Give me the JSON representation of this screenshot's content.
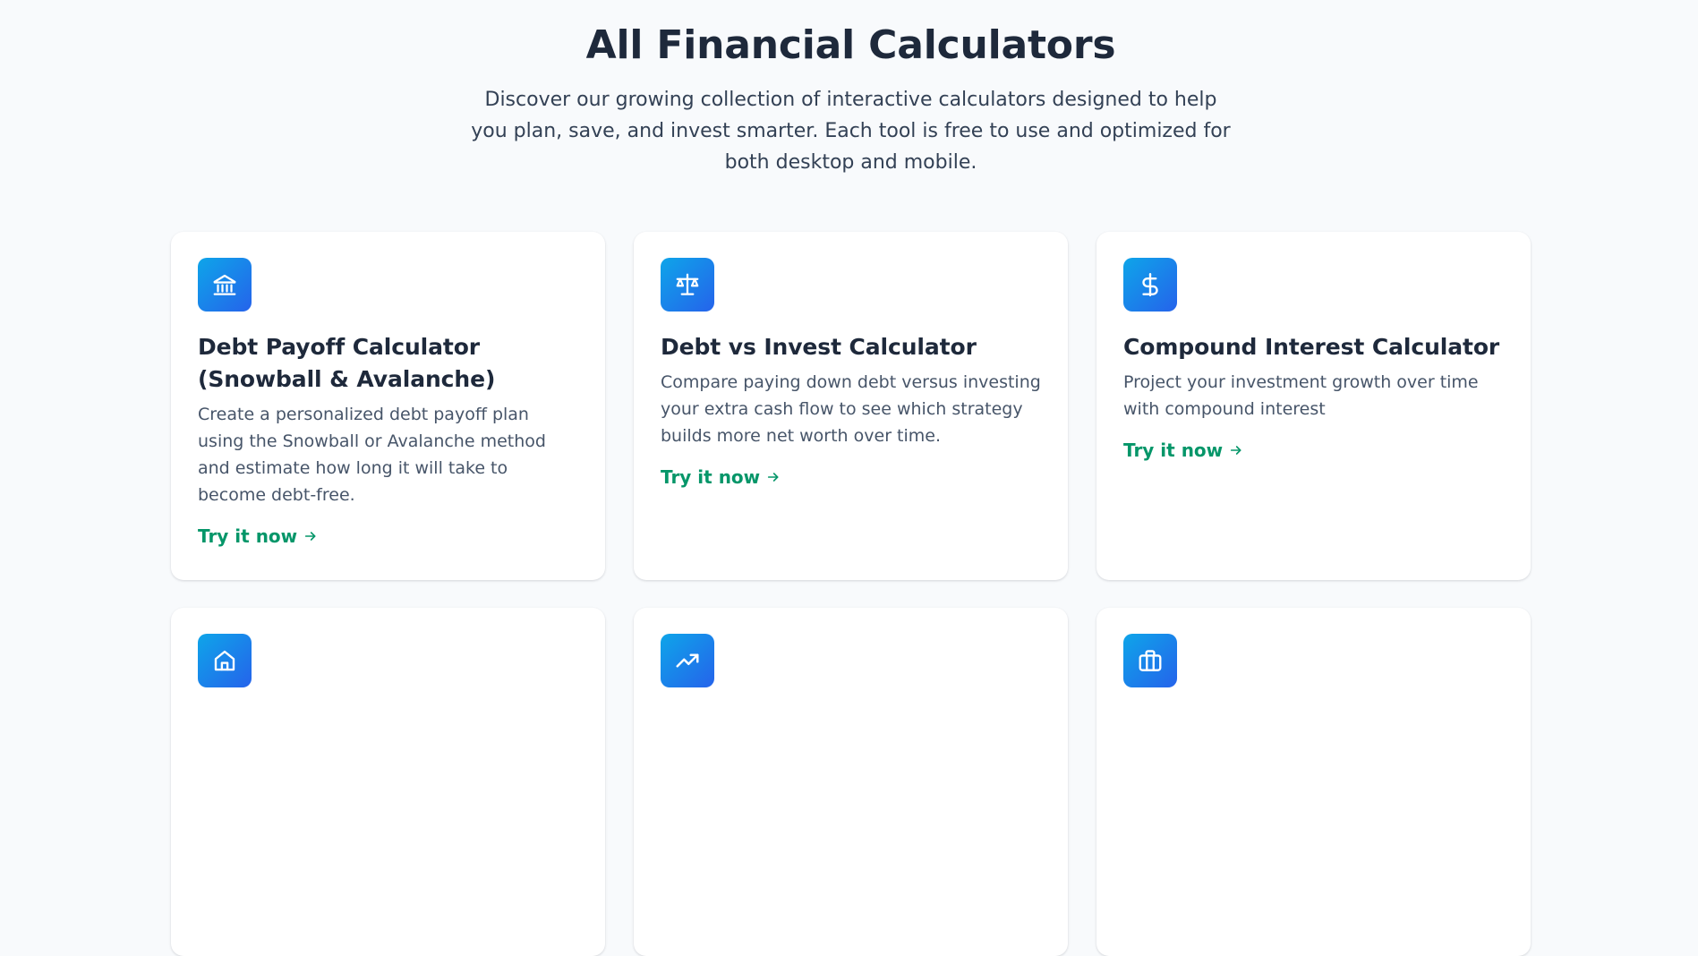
{
  "header": {
    "title": "All Financial Calculators",
    "subtitle": "Discover our growing collection of interactive calculators designed to help you plan, save, and invest smarter. Each tool is free to use and optimized for both desktop and mobile."
  },
  "colors": {
    "accent_gradient_start": "#0ea5e9",
    "accent_gradient_end": "#2563eb",
    "link": "#059669",
    "heading": "#1e293b",
    "page_background": "#f8fafc"
  },
  "cards": [
    {
      "icon": "bank-icon",
      "title": "Debt Payoff Calculator (Snowball & Avalanche)",
      "description": "Create a personalized debt payoff plan using the Snowball or Avalanche method and estimate how long it will take to become debt-free.",
      "link_label": "Try it now"
    },
    {
      "icon": "scale-icon",
      "title": "Debt vs Invest Calculator",
      "description": "Compare paying down debt versus investing your extra cash flow to see which strategy builds more net worth over time.",
      "link_label": "Try it now"
    },
    {
      "icon": "dollar-icon",
      "title": "Compound Interest Calculator",
      "description": "Project your investment growth over time with compound interest",
      "link_label": "Try it now"
    },
    {
      "icon": "home-icon"
    },
    {
      "icon": "trending-up-icon"
    },
    {
      "icon": "briefcase-icon"
    }
  ]
}
